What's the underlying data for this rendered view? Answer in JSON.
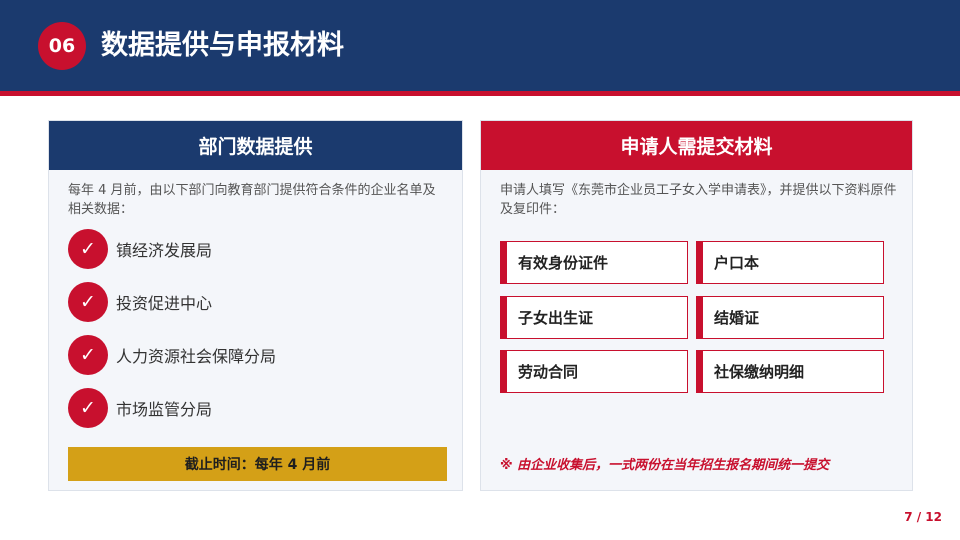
{
  "header": {
    "badge": "06",
    "title": "数据提供与申报材料"
  },
  "left_panel": {
    "title": "部门数据提供",
    "intro": "每年 4 月前，由以下部门向教育部门提供符合条件的企业名单及相关数据：",
    "check_glyph": "✓",
    "items": [
      "镇经济发展局",
      "投资促进中心",
      "人力资源社会保障分局",
      "市场监管分局"
    ],
    "deadline": "截止时间：每年 4 月前"
  },
  "right_panel": {
    "title": "申请人需提交材料",
    "intro": "申请人填写《东莞市企业员工子女入学申请表》，并提供以下资料原件及复印件：",
    "materials": [
      "有效身份证件",
      "户口本",
      "子女出生证",
      "结婚证",
      "劳动合同",
      "社保缴纳明细"
    ],
    "note": "※ 由企业收集后，一式两份在当年招生报名期间统一提交"
  },
  "footer": {
    "page": "7 / 12"
  },
  "colors": {
    "navy": "#1b3a6e",
    "red": "#c8102e",
    "gold": "#d4a017"
  }
}
